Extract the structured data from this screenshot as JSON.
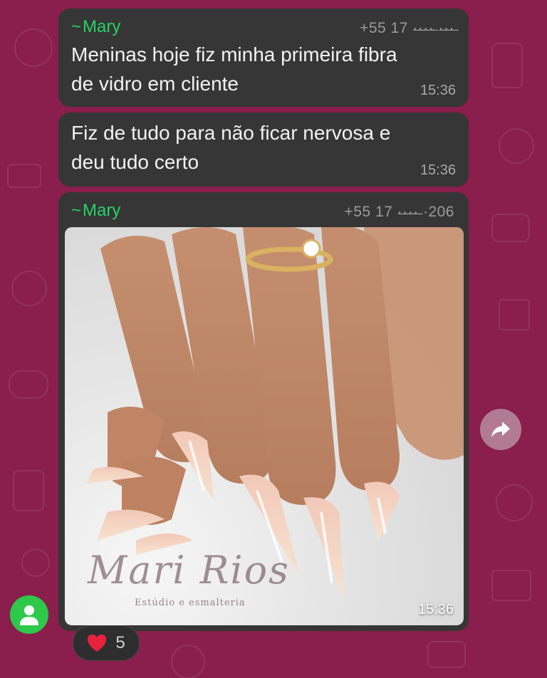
{
  "messages": [
    {
      "sender": "Mary",
      "phone": "+55 17 ·̶·̶·̶·̶ ·̶·̶·̶",
      "text_line1": "Meninas hoje fiz minha primeira fibra",
      "text_line2": "de vidro em cliente",
      "time": "15:36"
    },
    {
      "text_line1": "Fiz de tudo para não ficar nervosa e",
      "text_line2": "deu tudo certo",
      "time": "15:36"
    },
    {
      "sender": "Mary",
      "phone": "+55 17 ·̶·̶·̶·̶ ·206",
      "time": "15:36",
      "watermark_name": "Mari Rios",
      "watermark_sub": "Estúdio e esmalteria"
    }
  ],
  "reaction": {
    "emoji": "heart",
    "count": "5"
  },
  "icons": {
    "forward": "forward-arrow-icon",
    "avatar": "user-avatar-icon"
  },
  "colors": {
    "background": "#8a1e4d",
    "bubble": "#363636",
    "sender": "#25d366",
    "avatar": "#2ec84a"
  }
}
